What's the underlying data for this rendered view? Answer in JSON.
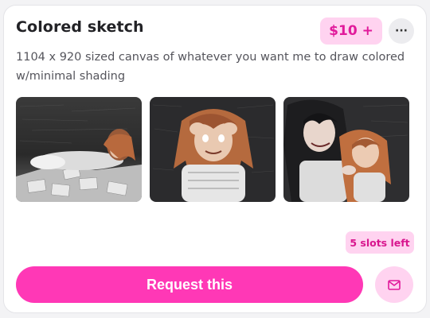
{
  "item": {
    "title": "Colored sketch",
    "price": "$10 +",
    "more_icon": "ellipsis-icon",
    "description": "1104 x 920 sized canvas of whatever you want me to draw colored w/minimal shading",
    "gallery": [
      {
        "name": "example-image-1"
      },
      {
        "name": "example-image-2"
      },
      {
        "name": "example-image-3"
      }
    ],
    "slots": "5 slots left",
    "request_label": "Request this",
    "message_icon": "mail-icon"
  },
  "colors": {
    "accent": "#ff38b6",
    "accent_light": "#ffd3f0",
    "accent_text": "#e11a9b"
  }
}
